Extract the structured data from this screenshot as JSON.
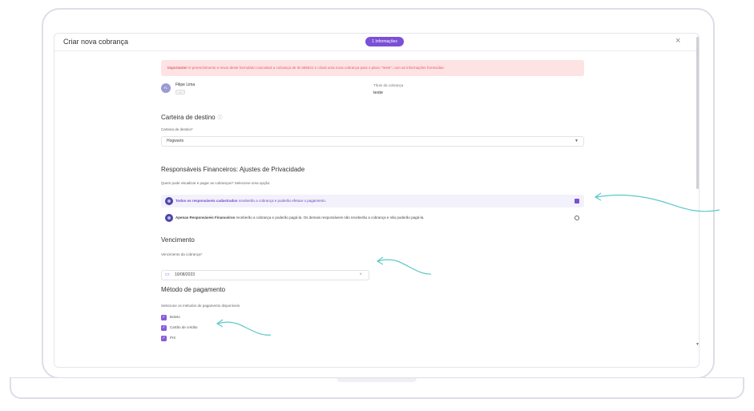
{
  "modal": {
    "title": "Criar nova cobrança",
    "step_label": "1 Informações",
    "close_glyph": "×"
  },
  "alert": {
    "strong": "Importante!",
    "text": " O preenchimento e envio deste formulário cancelará a cobrança de ID 695821 e criará uma nova cobrança para o plano \"teste\", com as informações fornecidas."
  },
  "client": {
    "initials": "FL",
    "name": "Filipe Lima",
    "badge": "—"
  },
  "charge_title": {
    "label": "Título da cobrança",
    "value": "teste"
  },
  "wallet": {
    "section_title": "Carteira de destino",
    "info_glyph": "ⓘ",
    "field_label": "Carteira de destino*",
    "value": "Hogwarts"
  },
  "privacy": {
    "section_title": "Responsáveis Financeiros: Ajustes de Privacidade",
    "question": "Quem pode visualizar e pagar as cobranças? Selecione uma opção:",
    "options": [
      {
        "strong": "Todos os responsáveis cadastrados",
        "text": " receberão a cobrança e poderão efetuar o pagamento.",
        "selected": true
      },
      {
        "strong": "Apenas Responsáveis Financeiros",
        "text": " receberão a cobrança e poderão pagá-la. Os demais responsáveis não receberão a cobrança e não poderão pagá-la.",
        "selected": false
      }
    ]
  },
  "due": {
    "section_title": "Vencimento",
    "field_label": "Vencimento da cobrança*",
    "value": "10/08/2023"
  },
  "payment": {
    "section_title": "Método de pagamento",
    "hint": "Selecione os métodos de pagamento disponíveis",
    "methods": [
      "Boleto",
      "Cartão de crédito",
      "PIX"
    ]
  },
  "colors": {
    "accent": "#7b4fd6",
    "annotation": "#5cc8c8",
    "alert_bg": "#fde3e3",
    "alert_text": "#e0606c"
  }
}
